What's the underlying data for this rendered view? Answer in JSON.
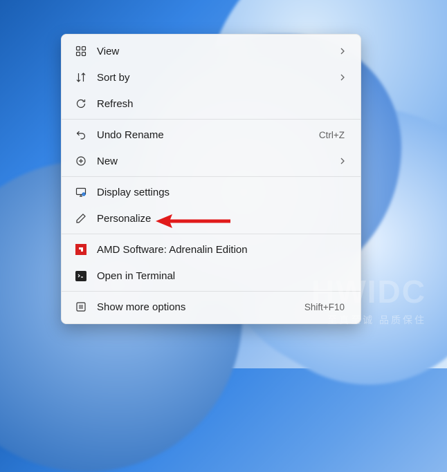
{
  "menu": {
    "view": {
      "label": "View"
    },
    "sort_by": {
      "label": "Sort by"
    },
    "refresh": {
      "label": "Refresh"
    },
    "undo_rename": {
      "label": "Undo Rename",
      "shortcut": "Ctrl+Z"
    },
    "new": {
      "label": "New"
    },
    "display_settings": {
      "label": "Display settings"
    },
    "personalize": {
      "label": "Personalize"
    },
    "amd": {
      "label": "AMD Software: Adrenalin Edition"
    },
    "terminal": {
      "label": "Open in Terminal"
    },
    "more_options": {
      "label": "Show more options",
      "shortcut": "Shift+F10"
    }
  },
  "watermark": {
    "big": "HWIDC",
    "small": "至真至诚 品质保住"
  },
  "colors": {
    "arrow": "#e11b1b",
    "amd": "#d72020"
  }
}
